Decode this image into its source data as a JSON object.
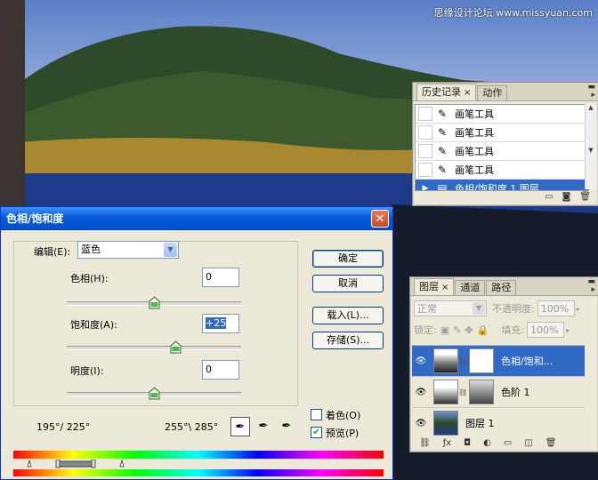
{
  "watermark": "思缘设计论坛 www.missyuan.com",
  "history_panel": {
    "tabs": [
      {
        "label": "历史记录",
        "close": "×"
      },
      {
        "label": "动作"
      }
    ],
    "items": [
      {
        "label": "画笔工具",
        "icon": "brush-icon"
      },
      {
        "label": "画笔工具",
        "icon": "brush-icon"
      },
      {
        "label": "画笔工具",
        "icon": "brush-icon"
      },
      {
        "label": "画笔工具",
        "icon": "brush-icon"
      },
      {
        "label": "色相/饱和度 1 图层",
        "icon": "adjustment-layer-icon",
        "selected": true
      }
    ]
  },
  "layers_panel": {
    "tabs": [
      {
        "label": "图层",
        "close": "×"
      },
      {
        "label": "通道"
      },
      {
        "label": "路径"
      }
    ],
    "blend_mode": "正常",
    "opacity_label": "不透明度:",
    "opacity_value": "100%",
    "lock_label": "锁定:",
    "fill_label": "填充:",
    "fill_value": "100%",
    "layers": [
      {
        "name": "色相/饱和...",
        "selected": true
      },
      {
        "name": "色阶 1"
      },
      {
        "name": "图层 1"
      }
    ]
  },
  "dialog": {
    "title": "色相/饱和度",
    "close": "✕",
    "edit_label": "编辑(E):",
    "edit_value": "蓝色",
    "hue_label": "色相(H):",
    "hue_value": "0",
    "saturation_label": "饱和度(A):",
    "saturation_value": "+25",
    "lightness_label": "明度(I):",
    "lightness_value": "0",
    "ok_label": "确定",
    "cancel_label": "取消",
    "load_label": "载入(L)...",
    "save_label": "存储(S)...",
    "colorize_label": "着色(O)",
    "colorize_checked": false,
    "preview_label": "预览(P)",
    "preview_checked": true,
    "range_left": "195°/ 225°",
    "range_right": "255°\\ 285°",
    "slider_levels": {
      "hue": 0.5,
      "saturation": 0.625,
      "lightness": 0.5
    }
  }
}
